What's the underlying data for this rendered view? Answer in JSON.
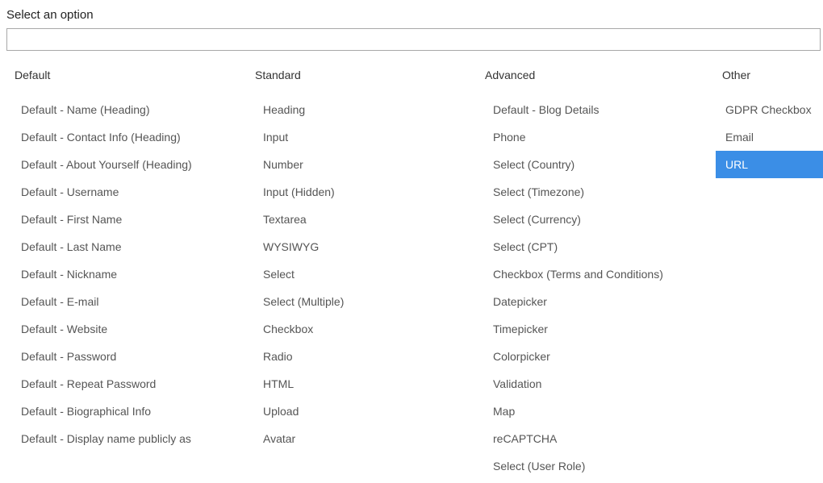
{
  "title": "Select an option",
  "search": {
    "value": "",
    "placeholder": ""
  },
  "columns": {
    "default": {
      "header": "Default",
      "items": [
        "Default - Name (Heading)",
        "Default - Contact Info (Heading)",
        "Default - About Yourself (Heading)",
        "Default - Username",
        "Default - First Name",
        "Default - Last Name",
        "Default - Nickname",
        "Default - E-mail",
        "Default - Website",
        "Default - Password",
        "Default - Repeat Password",
        "Default - Biographical Info",
        "Default - Display name publicly as"
      ]
    },
    "standard": {
      "header": "Standard",
      "items": [
        "Heading",
        "Input",
        "Number",
        "Input (Hidden)",
        "Textarea",
        "WYSIWYG",
        "Select",
        "Select (Multiple)",
        "Checkbox",
        "Radio",
        "HTML",
        "Upload",
        "Avatar"
      ]
    },
    "advanced": {
      "header": "Advanced",
      "items": [
        "Default - Blog Details",
        "Phone",
        "Select (Country)",
        "Select (Timezone)",
        "Select (Currency)",
        "Select (CPT)",
        "Checkbox (Terms and Conditions)",
        "Datepicker",
        "Timepicker",
        "Colorpicker",
        "Validation",
        "Map",
        "reCAPTCHA",
        "Select (User Role)"
      ]
    },
    "other": {
      "header": "Other",
      "items": [
        "GDPR Checkbox",
        "Email",
        "URL"
      ]
    }
  },
  "selected": "URL",
  "colors": {
    "highlight_bg": "#3b8ee6",
    "highlight_fg": "#ffffff"
  }
}
